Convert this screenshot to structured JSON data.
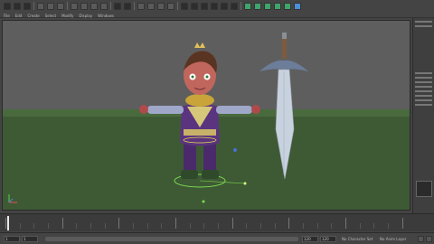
{
  "menubar": {
    "menus": [
      "File",
      "Edit",
      "Create",
      "Select",
      "Modify",
      "Display",
      "Windows"
    ]
  },
  "viewport": {
    "label": ""
  },
  "timeline": {
    "current_frame": 1
  },
  "rangebar": {
    "start": "1",
    "end": "1",
    "anim_start": "120",
    "anim_end": "120",
    "character_set": "No Character Set",
    "anim_layer": "No Anim Layer"
  },
  "colors": {
    "ground": "#3e5a35",
    "sky": "#5e5e5e",
    "ui_dark": "#444444",
    "accent_green": "#3fa56b"
  },
  "icons": [
    "select-tool-icon",
    "move-tool-icon",
    "rotate-tool-icon",
    "scale-tool-icon",
    "render-icon",
    "snap-grid-icon",
    "snap-curve-icon",
    "snap-point-icon"
  ]
}
